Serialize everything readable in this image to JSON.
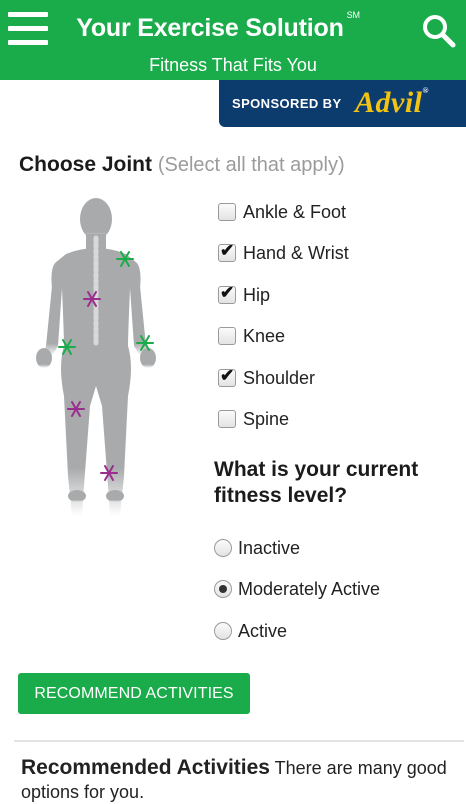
{
  "header": {
    "title": "Your Exercise Solution",
    "title_mark": "SM",
    "subtitle": "Fitness That Fits You",
    "background": "#1aac4a",
    "menu_icon": "hamburger-menu-icon",
    "search_icon": "search-icon"
  },
  "sponsor": {
    "label": "SPONSORED BY",
    "brand": "Advil",
    "brand_mark": "®",
    "background": "#0c3b6e",
    "brand_color": "#f2c311"
  },
  "joint_section": {
    "heading": "Choose Joint",
    "hint": "(Select all that apply)",
    "figure_icon": "human-body-figure",
    "marker_colors": {
      "selected": "#1aac4a",
      "unselected": "#9a2e8e"
    },
    "options": [
      {
        "label": "Ankle & Foot",
        "checked": false
      },
      {
        "label": "Hand & Wrist",
        "checked": true
      },
      {
        "label": "Hip",
        "checked": true
      },
      {
        "label": "Knee",
        "checked": false
      },
      {
        "label": "Shoulder",
        "checked": true
      },
      {
        "label": "Spine",
        "checked": false
      }
    ]
  },
  "fitness_section": {
    "heading": "What is your current fitness level?",
    "options": [
      {
        "label": "Inactive",
        "selected": false
      },
      {
        "label": "Moderately Active",
        "selected": true
      },
      {
        "label": "Active",
        "selected": false
      }
    ]
  },
  "recommend_button": {
    "label": "RECOMMEND ACTIVITIES"
  },
  "recommended": {
    "title": "Recommended Activities",
    "text": "There are many good options for you."
  }
}
